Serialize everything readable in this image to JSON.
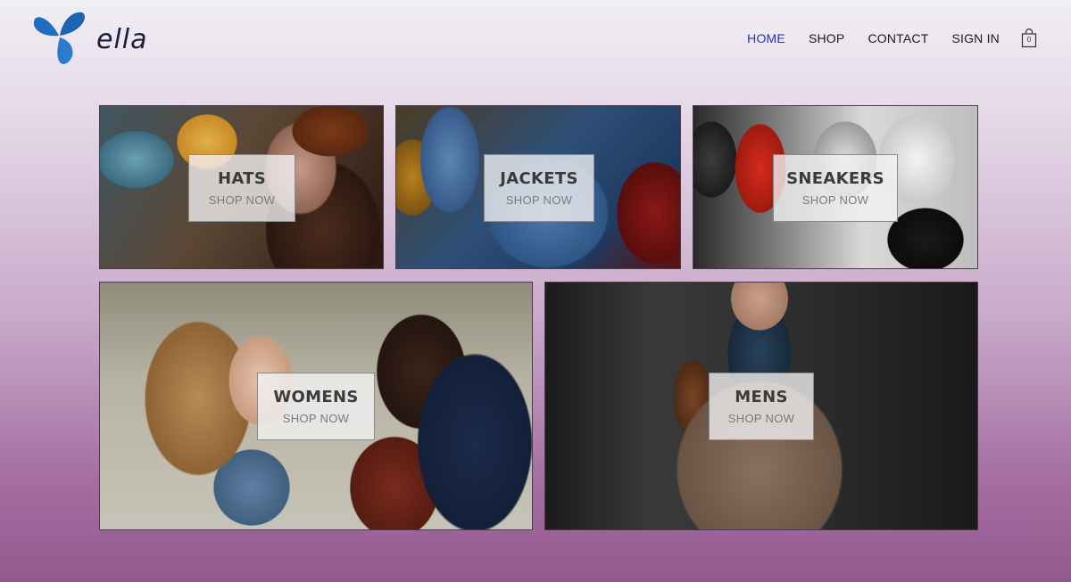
{
  "brand": {
    "name": "ella",
    "accent_color": "#1f6fc1"
  },
  "nav": {
    "items": [
      {
        "label": "HOME",
        "active": true
      },
      {
        "label": "SHOP",
        "active": false
      },
      {
        "label": "CONTACT",
        "active": false
      },
      {
        "label": "SIGN IN",
        "active": false
      }
    ],
    "active_color": "#2632b8",
    "cart": {
      "icon": "shopping-bag-icon",
      "count": "0"
    }
  },
  "categories": [
    {
      "title": "HATS",
      "cta": "SHOP NOW"
    },
    {
      "title": "JACKETS",
      "cta": "SHOP NOW"
    },
    {
      "title": "SNEAKERS",
      "cta": "SHOP NOW"
    },
    {
      "title": "WOMENS",
      "cta": "SHOP NOW"
    },
    {
      "title": "MENS",
      "cta": "SHOP NOW"
    }
  ]
}
